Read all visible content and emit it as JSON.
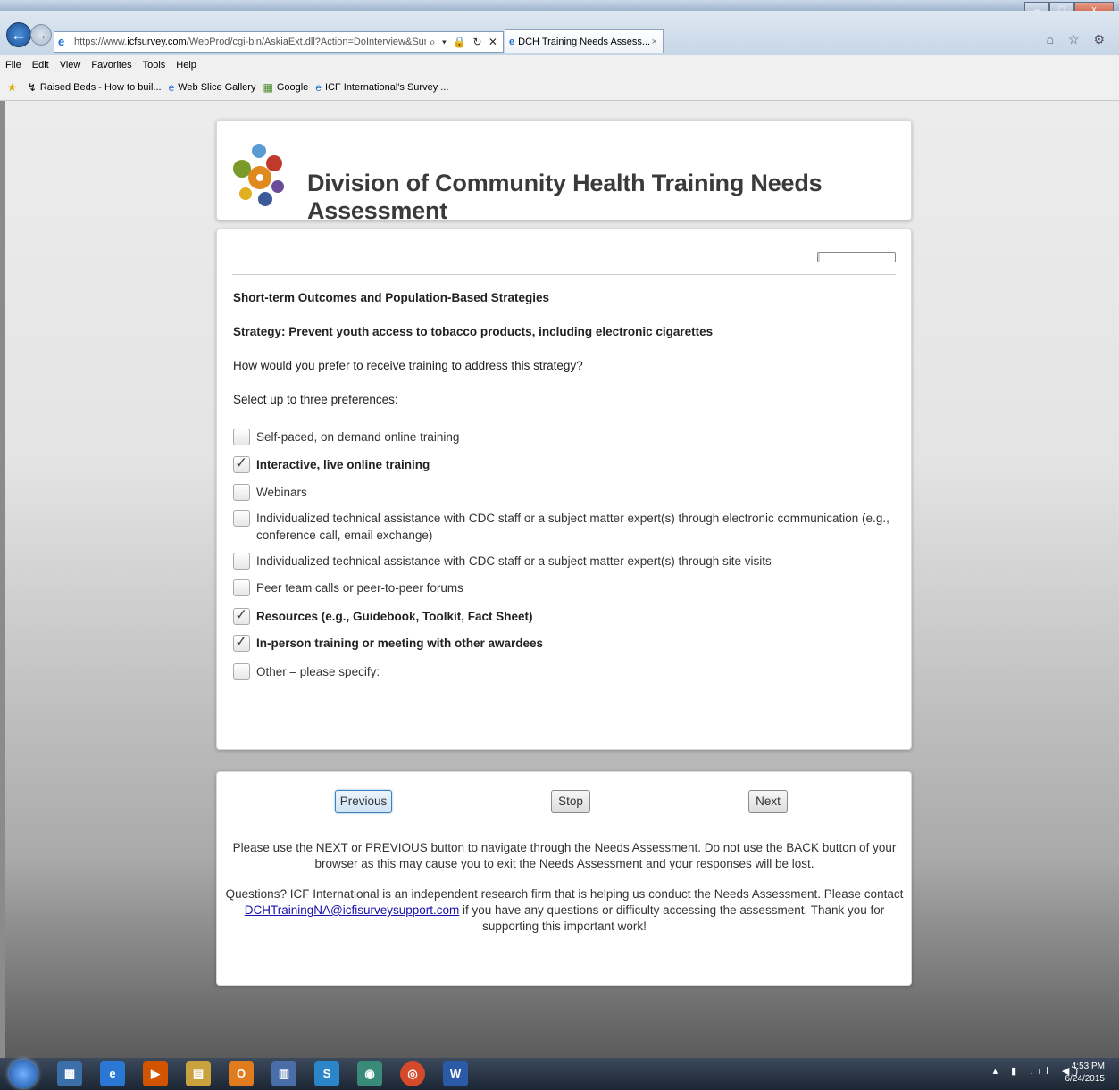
{
  "browser": {
    "url_prefix": "https://www.",
    "url_domain": "icfsurvey.com",
    "url_path": "/WebProd/cgi-bin/AskiaExt.dll?Action=DoInterview&Survey=ICEFZSS",
    "tab_title": "DCH Training Needs Assess...",
    "tab_close": "×",
    "back": "←",
    "forward": "→",
    "address_tools": "⌕ ▾ 🔒 ↻ ✕",
    "right_icons": "⌂ ☆ ⚙"
  },
  "window_controls": {
    "minimize": "–",
    "maximize": "□",
    "close": "x"
  },
  "menu": [
    "File",
    "Edit",
    "View",
    "Favorites",
    "Tools",
    "Help"
  ],
  "favorites": [
    {
      "icon": "★",
      "label": ""
    },
    {
      "icon": "↯",
      "label": "Raised Beds - How to buil..."
    },
    {
      "icon": "e",
      "label": "Web Slice Gallery"
    },
    {
      "icon": "▦",
      "label": "Google"
    },
    {
      "icon": "e",
      "label": "ICF International's Survey ..."
    }
  ],
  "header": {
    "title": "Division of Community Health Training Needs Assessment"
  },
  "progress": {
    "value": 0.02
  },
  "survey": {
    "section": "Short-term Outcomes and Population-Based Strategies",
    "strategy": "Strategy: Prevent youth access to tobacco products, including electronic cigarettes",
    "question": "How would you prefer to receive training to address this strategy?",
    "instruction": "Select up to three preferences:",
    "options": [
      {
        "label": "Self-paced, on demand online training",
        "checked": false
      },
      {
        "label": "Interactive, live online training",
        "checked": true
      },
      {
        "label": "Webinars",
        "checked": false
      },
      {
        "label": "Individualized technical assistance with CDC staff or a subject matter expert(s) through electronic communication (e.g., conference call, email exchange)",
        "checked": false
      },
      {
        "label": "Individualized technical assistance with CDC staff or a subject matter expert(s) through site visits",
        "checked": false
      },
      {
        "label": "Peer team calls or peer-to-peer forums",
        "checked": false
      },
      {
        "label": "Resources (e.g., Guidebook, Toolkit, Fact Sheet)",
        "checked": true
      },
      {
        "label": "In-person training or meeting with other awardees",
        "checked": true
      },
      {
        "label": "Other – please specify:",
        "checked": false
      }
    ]
  },
  "navigation": {
    "previous": "Previous",
    "stop": "Stop",
    "next": "Next",
    "notice": "Please use the NEXT or PREVIOUS button to navigate through the Needs Assessment. Do not use the BACK button of your browser as this may cause you to exit the Needs Assessment and your responses will be lost.",
    "questions_pre": "Questions? ICF International is an independent research firm that is helping us conduct the Needs Assessment. Please contact",
    "support_email": "DCHTrainingNA@icfisurveysupport.com",
    "questions_post": " if you have any questions or difficulty accessing the assessment. Thank you for supporting this important work!"
  },
  "taskbar": {
    "apps": [
      "▦",
      "e",
      "▶",
      "▤",
      "O",
      "▥",
      "S",
      "◉",
      "◎",
      "W"
    ],
    "tray": "▴ ▮ .ıl ◀)",
    "time": "4:53 PM",
    "date": "6/24/2015"
  },
  "colors": {
    "accent": "#3d7fb8",
    "link": "#1a0dab",
    "title": "#3a3a3a"
  }
}
